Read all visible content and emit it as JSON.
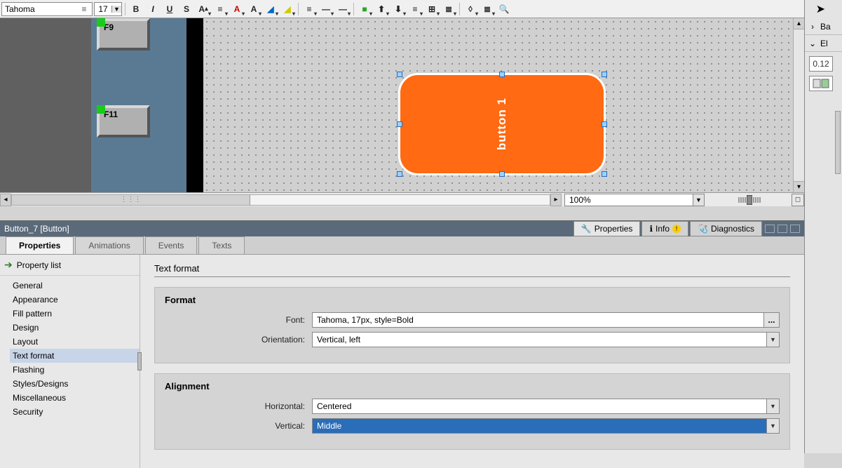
{
  "toolbar": {
    "font_name": "Tahoma",
    "font_size": "17",
    "buttons": [
      "B",
      "I",
      "U",
      "S",
      "A",
      "A",
      "≡",
      "A",
      "A",
      "A",
      "A",
      "≡",
      "≡",
      "≡",
      "■",
      "A",
      "A",
      "≣",
      "⊞",
      "≣",
      "◊",
      "≣",
      "🔍"
    ]
  },
  "canvas": {
    "fkeys": [
      "F9",
      "F11"
    ],
    "selected_button_label": "button 1"
  },
  "editor": {
    "zoom_value": "100%"
  },
  "right": {
    "basic": "Ba",
    "elements": "El",
    "digital_icon": "0.12"
  },
  "inspector": {
    "object_title": "Button_7 [Button]",
    "main_tabs": {
      "properties": "Properties",
      "info": "Info",
      "diagnostics": "Diagnostics"
    },
    "sub_tabs": {
      "properties": "Properties",
      "animations": "Animations",
      "events": "Events",
      "texts": "Texts"
    },
    "nav_header": "Property list",
    "nav_items": [
      "General",
      "Appearance",
      "Fill pattern",
      "Design",
      "Layout",
      "Text format",
      "Flashing",
      "Styles/Designs",
      "Miscellaneous",
      "Security"
    ],
    "nav_selected": "Text format",
    "detail_title": "Text format",
    "groups": {
      "format": {
        "title": "Format",
        "font_label": "Font:",
        "font_value": "Tahoma, 17px, style=Bold",
        "orientation_label": "Orientation:",
        "orientation_value": "Vertical, left"
      },
      "alignment": {
        "title": "Alignment",
        "horizontal_label": "Horizontal:",
        "horizontal_value": "Centered",
        "vertical_label": "Vertical:",
        "vertical_value": "Middle"
      }
    }
  }
}
